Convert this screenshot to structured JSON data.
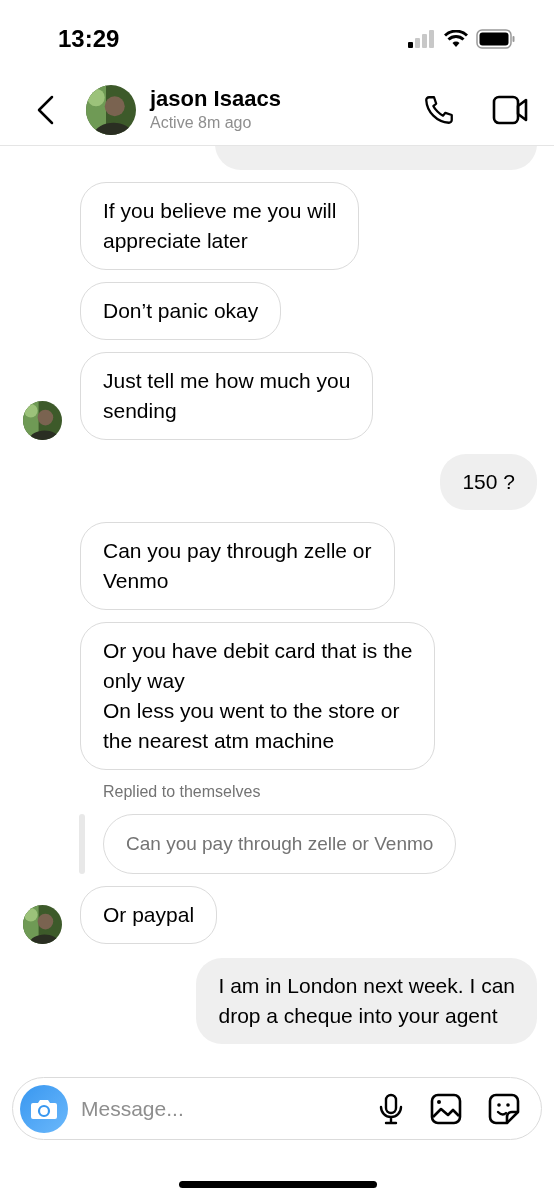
{
  "status_bar": {
    "time": "13:29"
  },
  "header": {
    "name": "jason Isaacs",
    "status": "Active 8m ago"
  },
  "messages": [
    {
      "kind": "outgoing_cut"
    },
    {
      "kind": "incoming",
      "text": "If you believe me you will\nappreciate later",
      "show_avatar": false
    },
    {
      "kind": "incoming",
      "text": "Don’t panic okay",
      "show_avatar": false
    },
    {
      "kind": "incoming",
      "text": "Just tell me how much you\nsending",
      "show_avatar": true
    },
    {
      "kind": "outgoing",
      "text": "150 ?"
    },
    {
      "kind": "incoming",
      "text": "Can you pay through zelle or\nVenmo",
      "show_avatar": false
    },
    {
      "kind": "incoming",
      "paragraphs": [
        "Or you have debit card that is the\nonly way",
        "On less you went to the store or\nthe nearest atm machine"
      ],
      "show_avatar": false
    },
    {
      "kind": "reply_note",
      "text": "Replied to themselves"
    },
    {
      "kind": "quoted",
      "text": "Can you pay through zelle or Venmo"
    },
    {
      "kind": "incoming",
      "text": "Or paypal",
      "show_avatar": true
    },
    {
      "kind": "outgoing",
      "text": "I am in London next week. I can\ndrop a cheque into your agent"
    }
  ],
  "composer": {
    "placeholder": "Message..."
  }
}
